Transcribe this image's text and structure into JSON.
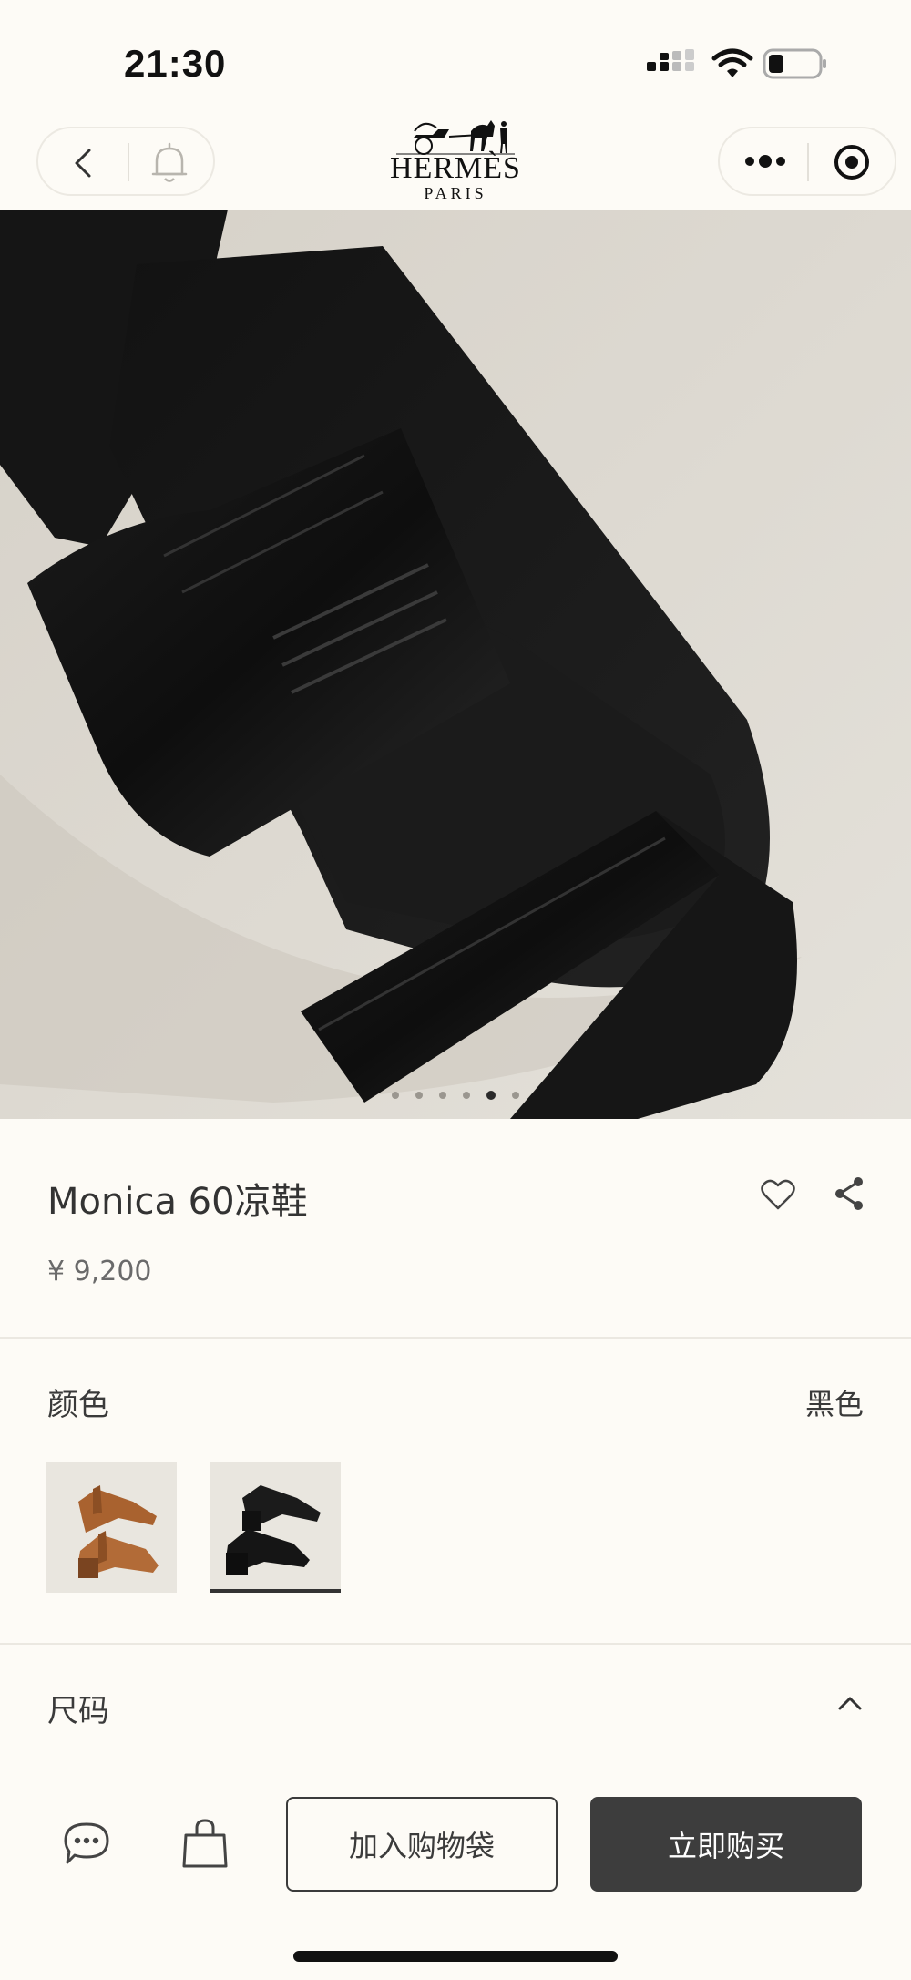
{
  "status_bar": {
    "time": "21:30",
    "icons": [
      "cellular-signal-icon",
      "wifi-icon",
      "battery-icon"
    ]
  },
  "nav": {
    "back_icon": "chevron-left-icon",
    "bell_icon": "bell-icon",
    "more_icon": "more-dots-icon",
    "close_icon": "target-circle-icon"
  },
  "brand": {
    "name": "HERMÈS",
    "city": "PARIS"
  },
  "gallery": {
    "slide_count": 6,
    "active_index": 4
  },
  "product": {
    "title": "Monica 60凉鞋",
    "price": "¥ 9,200"
  },
  "color_section": {
    "label": "颜色",
    "selected_value": "黑色",
    "swatches": [
      {
        "color": "#b06a3a",
        "selected": false
      },
      {
        "color": "#1a1a1a",
        "selected": true
      }
    ]
  },
  "size_section": {
    "label": "尺码"
  },
  "bottom_bar": {
    "add_to_bag": "加入购物袋",
    "buy_now": "立即购买"
  },
  "colors": {
    "background": "#fdfbf6",
    "image_background": "#dfdbd3",
    "primary_button": "#3d3d3d",
    "text": "#3a3a3a"
  }
}
